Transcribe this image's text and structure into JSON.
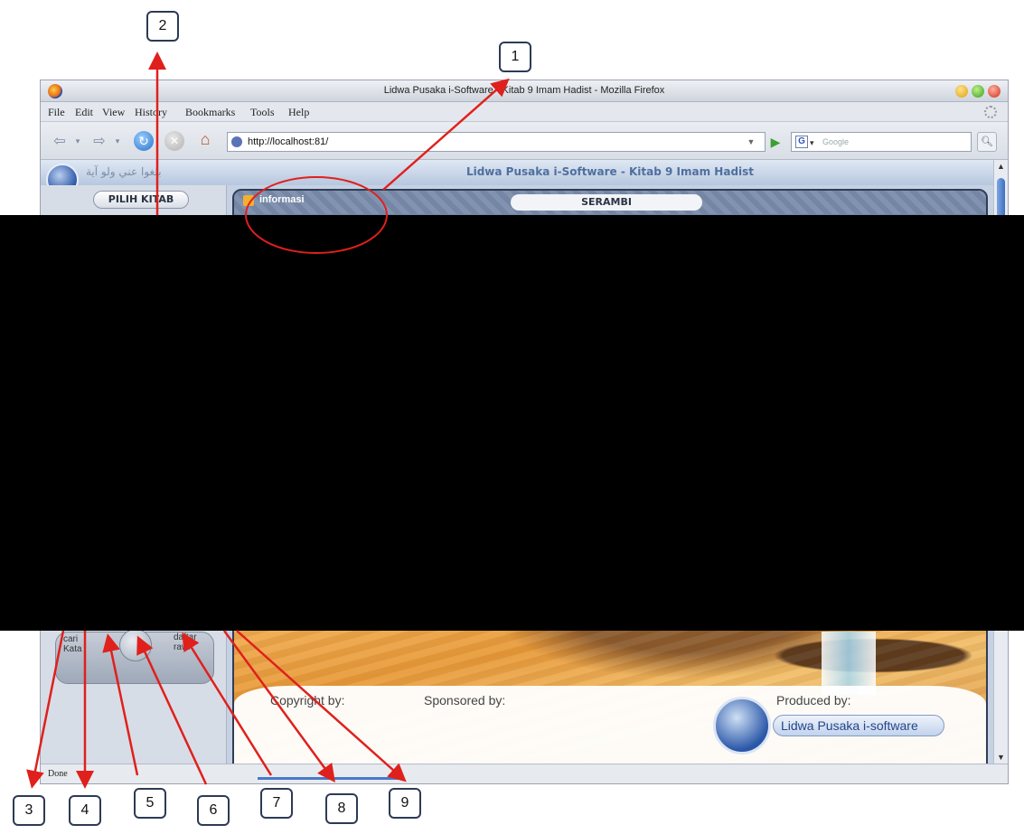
{
  "browser": {
    "window_title": "Lidwa Pusaka i-Software - Kitab 9 Imam Hadist - Mozilla Firefox",
    "menu": [
      "File",
      "Edit",
      "View",
      "History",
      "Bookmarks",
      "Tools",
      "Help"
    ],
    "url": "http://localhost:81/",
    "search_placeholder": "Google",
    "status": "Done"
  },
  "page": {
    "arabic_text": "بلغوا عني ولو آية",
    "site_title": "Lidwa Pusaka i-Software - Kitab 9 Imam Hadist",
    "pilih_kitab": "PILIH KITAB",
    "informasi": "informasi",
    "serambi": "SERAMBI",
    "side_nav": {
      "cari_kata": "cari\nKata",
      "daftar_rawi": "daftar\nrawi"
    },
    "footer": {
      "copyright": "Copyright by:",
      "sponsored": "Sponsored by:",
      "produced": "Produced by:",
      "lidwa": "Lidwa Pusaka i-software"
    }
  },
  "callouts": [
    "1",
    "2",
    "3",
    "4",
    "5",
    "6",
    "7",
    "8",
    "9"
  ],
  "colors": {
    "arrow": "#e0201c",
    "callout_border": "#2d3a55",
    "redaction": "#000000"
  }
}
